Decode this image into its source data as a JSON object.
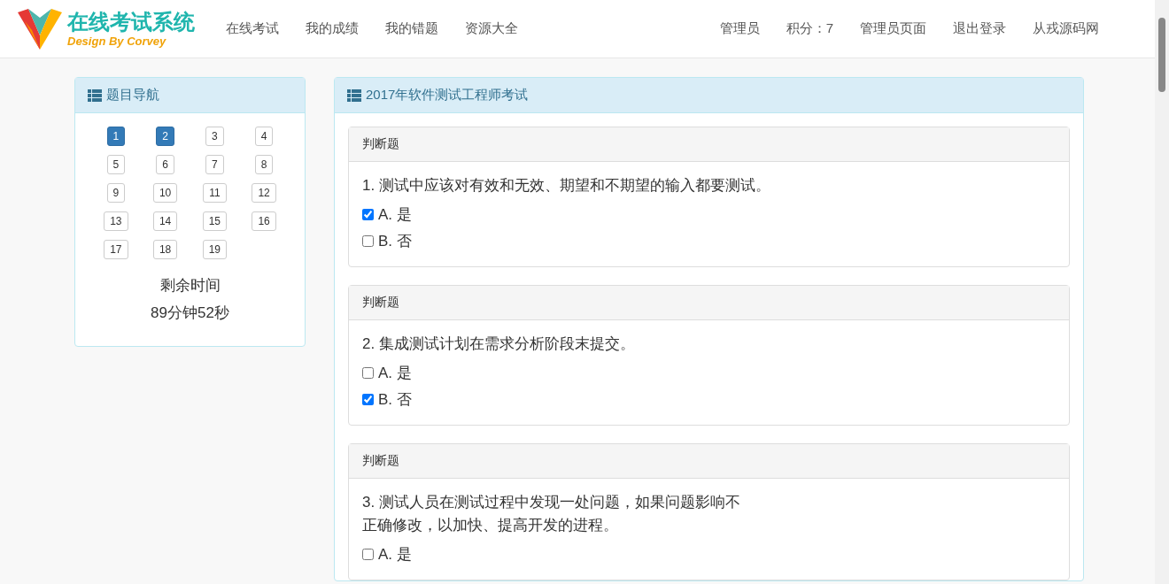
{
  "header": {
    "brand_title": "在线考试系统",
    "brand_subtitle": "Design By Corvey",
    "nav_left": [
      "在线考试",
      "我的成绩",
      "我的错题",
      "资源大全"
    ],
    "nav_right": [
      "管理员",
      "积分：7",
      "管理员页面",
      "退出登录",
      "从戎源码网"
    ]
  },
  "navigator": {
    "title": "题目导航",
    "items": [
      {
        "label": "1",
        "answered": true
      },
      {
        "label": "2",
        "answered": true
      },
      {
        "label": "3",
        "answered": false
      },
      {
        "label": "4",
        "answered": false
      },
      {
        "label": "5",
        "answered": false
      },
      {
        "label": "6",
        "answered": false
      },
      {
        "label": "7",
        "answered": false
      },
      {
        "label": "8",
        "answered": false
      },
      {
        "label": "9",
        "answered": false
      },
      {
        "label": "10",
        "answered": false
      },
      {
        "label": "11",
        "answered": false
      },
      {
        "label": "12",
        "answered": false
      },
      {
        "label": "13",
        "answered": false
      },
      {
        "label": "14",
        "answered": false
      },
      {
        "label": "15",
        "answered": false
      },
      {
        "label": "16",
        "answered": false
      },
      {
        "label": "17",
        "answered": false
      },
      {
        "label": "18",
        "answered": false
      },
      {
        "label": "19",
        "answered": false
      }
    ],
    "timer_label": "剩余时间",
    "timer_value": "89分钟52秒"
  },
  "exam": {
    "title": "2017年软件测试工程师考试",
    "questions": [
      {
        "type": "判断题",
        "text_lines": [
          "1. 测试中应该对有效和无效、期望和不期望的输入都要测试。"
        ],
        "options": [
          {
            "label": "A. 是",
            "checked": true
          },
          {
            "label": "B. 否",
            "checked": false
          }
        ]
      },
      {
        "type": "判断题",
        "text_lines": [
          "2. 集成测试计划在需求分析阶段末提交。"
        ],
        "options": [
          {
            "label": "A. 是",
            "checked": false
          },
          {
            "label": "B. 否",
            "checked": true
          }
        ]
      },
      {
        "type": "判断题",
        "text_lines": [
          "3. 测试人员在测试过程中发现一处问题，如果问题影响不",
          "正确修改，以加快、提高开发的进程。"
        ],
        "options": [
          {
            "label": "A. 是",
            "checked": false
          }
        ]
      }
    ]
  }
}
